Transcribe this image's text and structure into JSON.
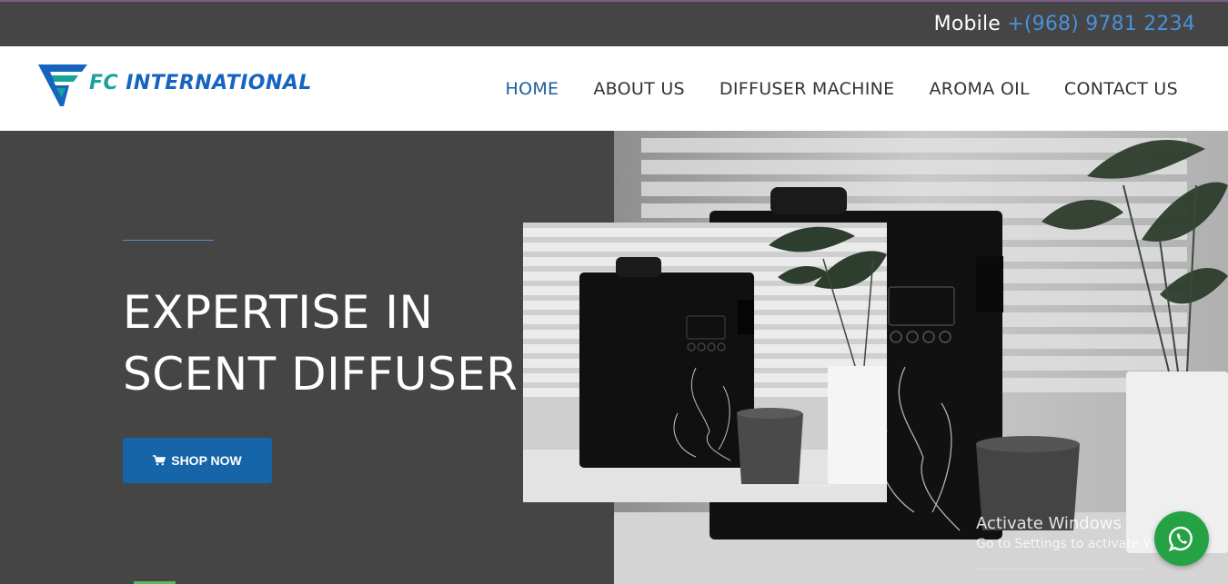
{
  "topbar": {
    "mobile_label": "Mobile",
    "phone": "+(968) 9781 2234"
  },
  "brand": {
    "fc": "FC",
    "name": "INTERNATIONAL"
  },
  "nav": {
    "items": [
      {
        "label": "HOME",
        "active": true
      },
      {
        "label": "ABOUT US",
        "active": false
      },
      {
        "label": "DIFFUSER MACHINE",
        "active": false
      },
      {
        "label": "AROMA OIL",
        "active": false
      },
      {
        "label": "CONTACT US",
        "active": false
      }
    ]
  },
  "hero": {
    "headline_line1": "EXPERTISE IN",
    "headline_line2": "SCENT DIFFUSER",
    "cta_label": "SHOP NOW",
    "cta_icon": "shopping-cart-icon"
  },
  "watermark": {
    "title": "Activate Windows",
    "subtitle": "Go to Settings to activate Windows."
  },
  "floating": {
    "icon": "whatsapp-icon"
  },
  "colors": {
    "topbar_bg": "#454545",
    "phone": "#4a90d9",
    "nav_active": "#1a5e9c",
    "hero_bg": "#454545",
    "cta_bg": "#1565a8",
    "logo_blue": "#1565c0",
    "logo_teal": "#1aa39b",
    "whatsapp": "#25a244"
  }
}
